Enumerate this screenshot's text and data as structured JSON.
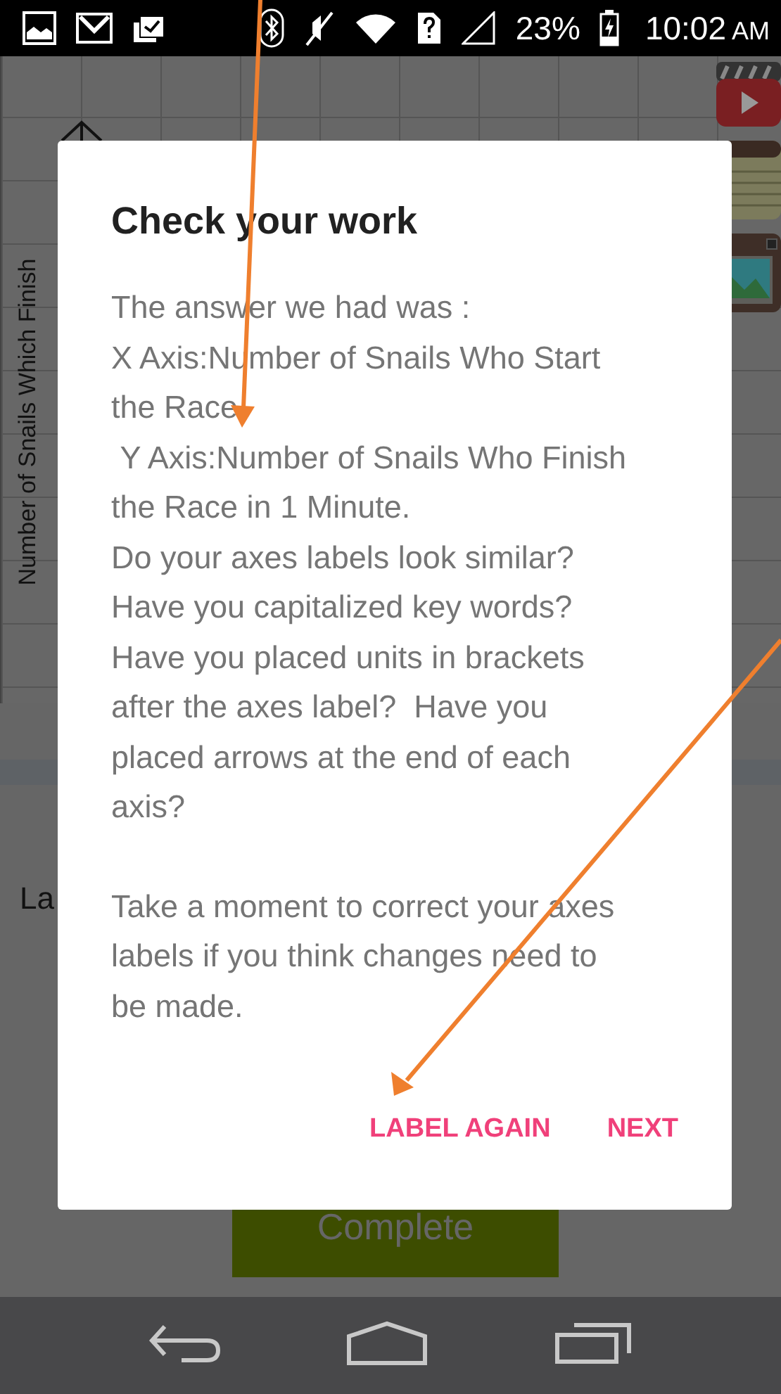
{
  "status_bar": {
    "battery": "23%",
    "time": "10:02",
    "meridiem": "AM"
  },
  "background": {
    "y_axis_label": "Number of Snails Which Finish",
    "partial_label": "La",
    "button": "Complete"
  },
  "dialog": {
    "title": "Check your work",
    "paragraphs": [
      "The answer we had was :\nX Axis:Number of Snails Who Start the Race\n Y Axis:Number of Snails Who Finish the Race in 1 Minute.\nDo your axes labels look similar?\nHave you capitalized key words?\nHave you placed units in brackets after the axes label?  Have you placed arrows at the end of each axis?",
      "Take a moment to correct your axes labels if you think changes need to be made."
    ],
    "buttons": [
      "LABEL AGAIN",
      "NEXT"
    ]
  }
}
